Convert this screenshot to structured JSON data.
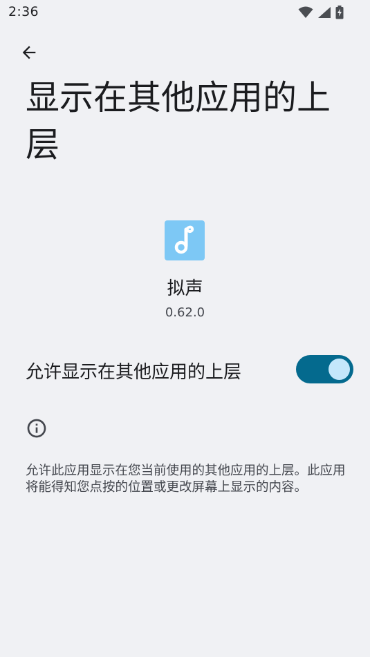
{
  "status_bar": {
    "time": "2:36",
    "icons": [
      "wifi-icon",
      "signal-icon",
      "battery-charging-icon"
    ]
  },
  "header": {
    "back_icon": "arrow-back-icon",
    "title": "显示在其他应用的上层"
  },
  "app": {
    "icon": "music-note-icon",
    "icon_color": "#7dc8f5",
    "name": "拟声",
    "version": "0.62.0"
  },
  "permission": {
    "label": "允许显示在其他应用的上层",
    "enabled": true,
    "toggle_color": "#046a8e"
  },
  "info": {
    "icon": "info-icon",
    "text": "允许此应用显示在您当前使用的其他应用的上层。此应用将能得知您点按的位置或更改屏幕上显示的内容。"
  }
}
